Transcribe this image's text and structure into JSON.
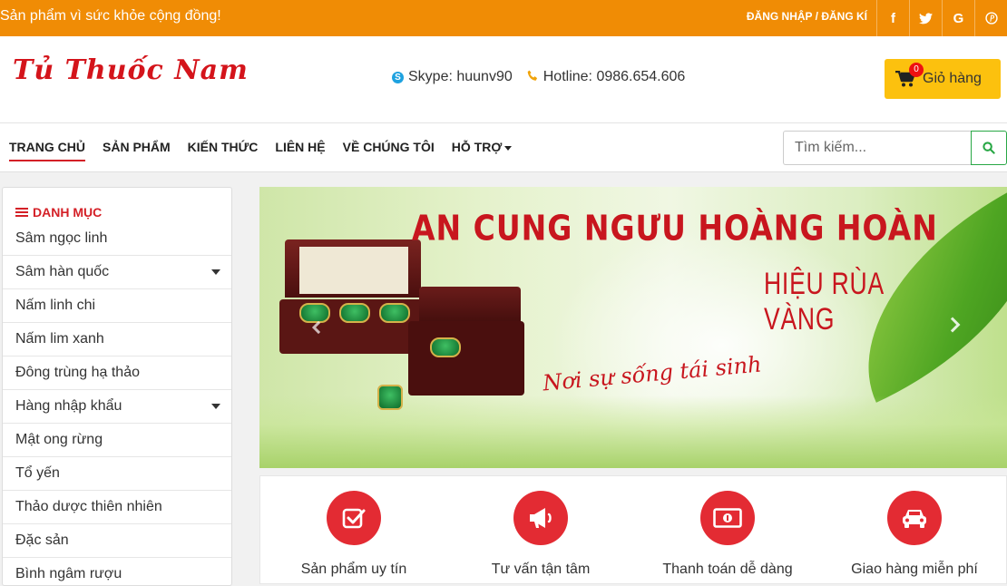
{
  "topbar": {
    "slogan": "Sản phẩm vì sức khỏe cộng đồng!",
    "auth_label": "ĐĂNG NHẬP / ĐĂNG KÍ",
    "social": [
      {
        "name": "facebook-icon",
        "glyph": "f"
      },
      {
        "name": "twitter-icon",
        "glyph": "t"
      },
      {
        "name": "google-icon",
        "glyph": "G"
      },
      {
        "name": "pinterest-icon",
        "glyph": "P"
      }
    ]
  },
  "header": {
    "logo_text": "Tủ Thuốc Nam",
    "skype_label": "Skype: huunv90",
    "hotline_label": "Hotline: 0986.654.606",
    "cart_label": "Giỏ hàng",
    "cart_count": "0"
  },
  "nav": {
    "items": [
      {
        "label": "TRANG CHỦ"
      },
      {
        "label": "SẢN PHẨM"
      },
      {
        "label": "KIẾN THỨC"
      },
      {
        "label": "LIÊN HỆ"
      },
      {
        "label": "VỀ CHÚNG TÔI"
      },
      {
        "label": "HỖ TRỢ"
      }
    ],
    "search_placeholder": "Tìm kiếm..."
  },
  "sidebar": {
    "title": "DANH MỤC",
    "categories": [
      {
        "label": "Sâm ngọc linh"
      },
      {
        "label": "Sâm hàn quốc"
      },
      {
        "label": "Nấm linh chi"
      },
      {
        "label": "Nấm lim xanh"
      },
      {
        "label": "Đông trùng hạ thảo"
      },
      {
        "label": "Hàng nhập khẩu"
      },
      {
        "label": "Mật ong rừng"
      },
      {
        "label": "Tổ yến"
      },
      {
        "label": "Thảo dược thiên nhiên"
      },
      {
        "label": "Đặc sản"
      },
      {
        "label": "Bình ngâm rượu"
      }
    ]
  },
  "banner": {
    "title": "AN CUNG NGƯU HOÀNG HOÀN",
    "subtitle": "HIỆU RÙA VÀNG",
    "script": "Nơi sự sống tái sinh"
  },
  "features": [
    {
      "label": "Sản phẩm uy tín"
    },
    {
      "label": "Tư vấn tận tâm"
    },
    {
      "label": "Thanh toán dễ dàng"
    },
    {
      "label": "Giao hàng miễn phí"
    }
  ],
  "colors": {
    "topbar": "#f08c05",
    "accent_red": "#d42027",
    "cart_yellow": "#fcc10e",
    "search_green": "#28a745"
  }
}
